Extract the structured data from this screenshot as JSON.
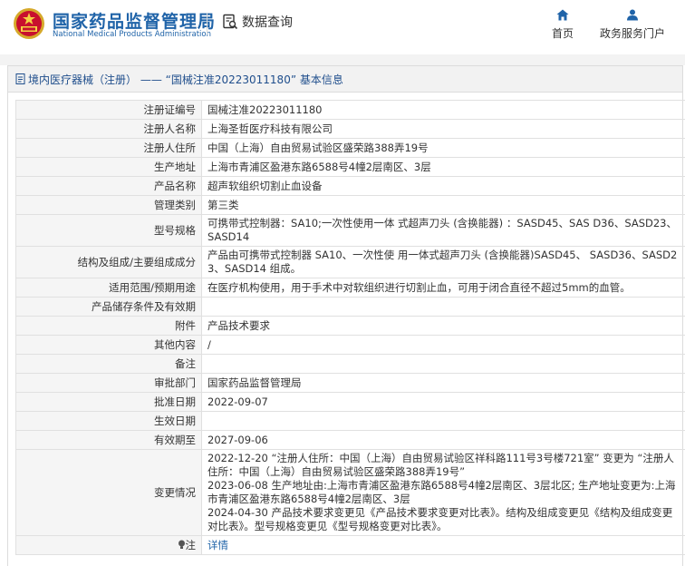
{
  "header": {
    "logo_cn": "国家药品监督管理局",
    "logo_en": "National Medical Products Administration",
    "query_label": "数据查询",
    "nav": [
      {
        "label": "首页",
        "icon": "home-icon"
      },
      {
        "label": "政务服务门户",
        "icon": "user-icon"
      }
    ]
  },
  "panel": {
    "title": "境内医疗器械（注册） —— “国械注准20223011180” 基本信息"
  },
  "rows": [
    {
      "key": "注册证编号",
      "value": "国械注准20223011180"
    },
    {
      "key": "注册人名称",
      "value": "上海圣哲医疗科技有限公司"
    },
    {
      "key": "注册人住所",
      "value": "中国（上海）自由贸易试验区盛荣路388弄19号"
    },
    {
      "key": "生产地址",
      "value": "上海市青浦区盈港东路6588号4幢2层南区、3层"
    },
    {
      "key": "产品名称",
      "value": "超声软组织切割止血设备"
    },
    {
      "key": "管理类别",
      "value": "第三类"
    },
    {
      "key": "型号规格",
      "value": "可携带式控制器：SA10;一次性使用一体 式超声刀头 (含换能器) ：SASD45、SAS D36、SASD23、SASD14"
    },
    {
      "key": "结构及组成/主要组成成分",
      "value": "产品由可携带式控制器 SA10、一次性使 用一体式超声刀头 (含换能器)SASD45、 SASD36、SASD23、SASD14 组成。"
    },
    {
      "key": "适用范围/预期用途",
      "value": "在医疗机构使用，用于手术中对软组织进行切割止血，可用于闭合直径不超过5mm的血管。"
    },
    {
      "key": "产品储存条件及有效期",
      "value": ""
    },
    {
      "key": "附件",
      "value": "产品技术要求"
    },
    {
      "key": "其他内容",
      "value": "/"
    },
    {
      "key": "备注",
      "value": ""
    },
    {
      "key": "审批部门",
      "value": "国家药品监督管理局"
    },
    {
      "key": "批准日期",
      "value": "2022-09-07"
    },
    {
      "key": "生效日期",
      "value": ""
    },
    {
      "key": "有效期至",
      "value": "2027-09-06"
    },
    {
      "key": "变更情况",
      "value": "2022-12-20 “注册人住所：中国（上海）自由贸易试验区祥科路111号3号楼721室” 变更为 “注册人住所：中国（上海）自由贸易试验区盛荣路388弄19号”\n2023-06-08 生产地址由:上海市青浦区盈港东路6588号4幢2层南区、3层北区; 生产地址变更为:上海市青浦区盈港东路6588号4幢2层南区、3层\n2024-04-30 产品技术要求变更见《产品技术要求变更对比表》。结构及组成变更见《结构及组成变更对比表》。型号规格变更见《型号规格变更对比表》。"
    },
    {
      "key": "注",
      "value": "详情",
      "icon": "lightbulb-icon"
    }
  ]
}
